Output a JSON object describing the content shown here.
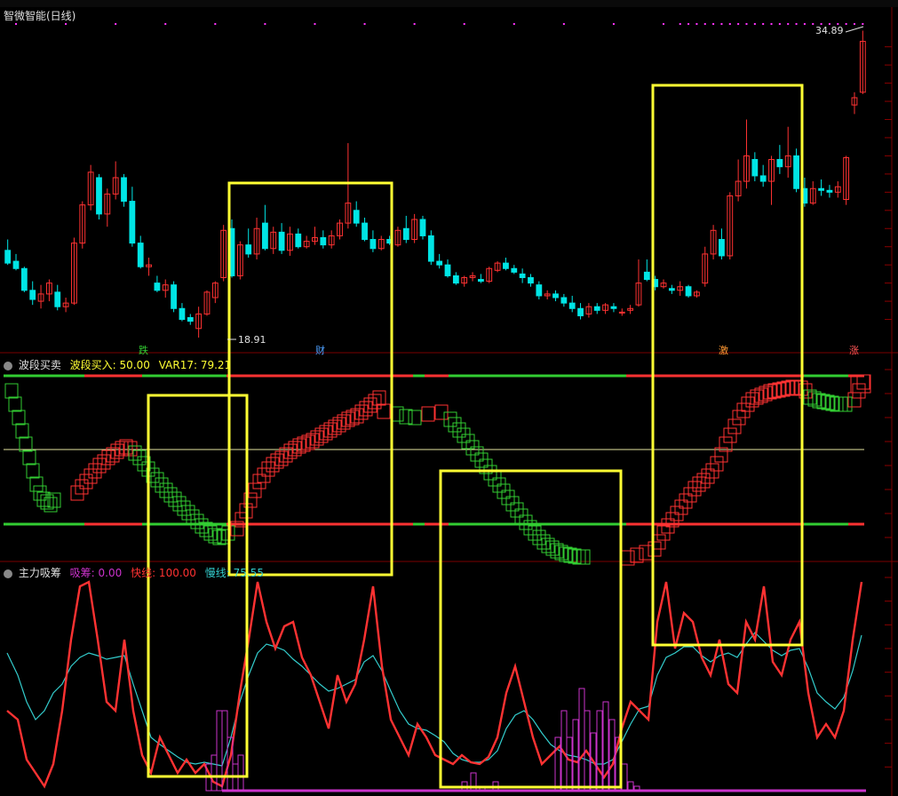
{
  "main_title": "智微智能(日线)",
  "high_label": "34.89",
  "low_label": "18.91",
  "markers": [
    "跌",
    "财",
    "激",
    "涨"
  ],
  "panel2": {
    "name": "波段买卖",
    "v1_label": "波段买入: 50.00",
    "v2_label": "VAR17: 79.21"
  },
  "panel3": {
    "name": "主力吸筹",
    "v1_label": "吸筹: 0.00",
    "v2_label": "快线: 100.00",
    "v3_label": "慢线: 75.55"
  },
  "colors": {
    "up": "#ff3232",
    "down": "#00e5e5",
    "green": "#32cd32",
    "yellow": "#ffff33",
    "magenta": "#cc33cc",
    "slow": "#33cccc",
    "grid": "#8b0000"
  },
  "chart_data": {
    "type": "candlestick",
    "candles": [
      [
        22.8,
        23.4,
        22.0,
        22.1
      ],
      [
        22.2,
        22.6,
        21.7,
        21.8
      ],
      [
        21.8,
        21.9,
        20.5,
        20.6
      ],
      [
        20.6,
        21.1,
        19.8,
        20.1
      ],
      [
        20.0,
        20.9,
        19.6,
        20.4
      ],
      [
        20.4,
        21.2,
        20.0,
        21.0
      ],
      [
        20.5,
        20.9,
        19.5,
        19.7
      ],
      [
        19.7,
        20.2,
        19.4,
        19.9
      ],
      [
        19.9,
        23.5,
        19.8,
        23.2
      ],
      [
        23.2,
        25.5,
        22.9,
        25.3
      ],
      [
        25.3,
        27.5,
        25.0,
        27.1
      ],
      [
        26.8,
        27.0,
        24.5,
        24.8
      ],
      [
        24.8,
        26.2,
        24.1,
        25.9
      ],
      [
        25.9,
        27.7,
        25.6,
        26.8
      ],
      [
        26.8,
        27.0,
        25.2,
        25.5
      ],
      [
        25.5,
        26.3,
        23.0,
        23.2
      ],
      [
        23.2,
        23.6,
        21.8,
        21.9
      ],
      [
        21.9,
        22.4,
        21.4,
        22.0
      ],
      [
        21.0,
        21.4,
        20.5,
        20.6
      ],
      [
        20.6,
        21.2,
        20.2,
        20.9
      ],
      [
        20.9,
        21.1,
        19.4,
        19.6
      ],
      [
        19.6,
        19.9,
        18.9,
        19.0
      ],
      [
        19.1,
        19.3,
        18.7,
        18.9
      ],
      [
        18.5,
        19.7,
        18.0,
        19.3
      ],
      [
        19.3,
        20.6,
        19.2,
        20.5
      ],
      [
        20.2,
        21.1,
        19.9,
        21.0
      ],
      [
        21.3,
        24.2,
        21.1,
        23.9
      ],
      [
        24.0,
        24.5,
        21.3,
        21.4
      ],
      [
        21.4,
        23.3,
        21.2,
        23.1
      ],
      [
        23.1,
        24.0,
        22.4,
        22.6
      ],
      [
        22.6,
        24.6,
        22.3,
        24.0
      ],
      [
        24.3,
        25.3,
        22.8,
        22.9
      ],
      [
        22.9,
        24.1,
        22.6,
        23.8
      ],
      [
        23.8,
        24.3,
        22.6,
        22.8
      ],
      [
        22.8,
        24.1,
        22.5,
        23.7
      ],
      [
        23.7,
        24.0,
        22.9,
        23.0
      ],
      [
        23.0,
        23.6,
        22.9,
        23.3
      ],
      [
        23.3,
        24.1,
        23.1,
        23.5
      ],
      [
        23.5,
        23.9,
        22.9,
        23.1
      ],
      [
        23.1,
        23.9,
        22.9,
        23.6
      ],
      [
        23.6,
        24.5,
        23.4,
        24.3
      ],
      [
        24.3,
        28.7,
        24.0,
        25.4
      ],
      [
        25.0,
        25.5,
        24.1,
        24.3
      ],
      [
        24.3,
        24.6,
        23.3,
        23.4
      ],
      [
        23.4,
        23.9,
        22.7,
        22.9
      ],
      [
        22.9,
        23.6,
        22.8,
        23.4
      ],
      [
        23.4,
        23.6,
        23.1,
        23.2
      ],
      [
        23.1,
        24.1,
        23.0,
        23.9
      ],
      [
        24.0,
        24.7,
        23.2,
        23.4
      ],
      [
        23.4,
        24.8,
        23.2,
        24.5
      ],
      [
        24.5,
        24.7,
        23.4,
        23.6
      ],
      [
        23.6,
        23.9,
        22.0,
        22.2
      ],
      [
        22.2,
        22.6,
        21.8,
        22.0
      ],
      [
        22.0,
        22.3,
        21.3,
        21.4
      ],
      [
        21.4,
        21.6,
        20.9,
        21.0
      ],
      [
        21.0,
        21.4,
        20.8,
        21.3
      ],
      [
        21.3,
        21.6,
        21.1,
        21.4
      ],
      [
        21.2,
        21.5,
        21.0,
        21.1
      ],
      [
        21.1,
        21.9,
        21.0,
        21.8
      ],
      [
        21.7,
        22.2,
        21.6,
        22.1
      ],
      [
        22.1,
        22.4,
        21.7,
        21.8
      ],
      [
        21.8,
        22.0,
        21.5,
        21.6
      ],
      [
        21.5,
        21.8,
        21.0,
        21.3
      ],
      [
        21.3,
        21.5,
        20.8,
        21.0
      ],
      [
        20.9,
        21.1,
        20.1,
        20.3
      ],
      [
        20.3,
        20.6,
        20.1,
        20.4
      ],
      [
        20.4,
        20.6,
        20.0,
        20.2
      ],
      [
        20.2,
        20.4,
        19.7,
        19.9
      ],
      [
        19.9,
        20.3,
        19.4,
        19.6
      ],
      [
        19.6,
        19.9,
        19.0,
        19.2
      ],
      [
        19.3,
        19.9,
        19.1,
        19.7
      ],
      [
        19.7,
        19.9,
        19.3,
        19.5
      ],
      [
        19.5,
        19.9,
        19.3,
        19.8
      ],
      [
        19.7,
        19.9,
        19.4,
        19.6
      ],
      [
        19.4,
        19.6,
        19.2,
        19.4
      ],
      [
        19.5,
        19.8,
        19.3,
        19.6
      ],
      [
        19.8,
        22.3,
        19.7,
        21.0
      ],
      [
        21.6,
        22.3,
        21.1,
        21.2
      ],
      [
        21.2,
        21.4,
        20.6,
        20.8
      ],
      [
        20.8,
        21.2,
        20.7,
        21.0
      ],
      [
        20.7,
        20.9,
        20.4,
        20.6
      ],
      [
        20.6,
        21.1,
        20.3,
        20.8
      ],
      [
        20.8,
        20.9,
        20.2,
        20.3
      ],
      [
        20.3,
        20.6,
        20.2,
        20.5
      ],
      [
        21.0,
        23.0,
        20.8,
        22.6
      ],
      [
        22.6,
        24.2,
        22.3,
        23.9
      ],
      [
        23.4,
        24.0,
        22.3,
        22.5
      ],
      [
        22.5,
        26.0,
        22.3,
        25.8
      ],
      [
        25.8,
        27.8,
        25.5,
        26.6
      ],
      [
        26.6,
        30.0,
        26.2,
        28.0
      ],
      [
        27.8,
        28.2,
        26.6,
        26.9
      ],
      [
        26.9,
        27.5,
        26.3,
        26.6
      ],
      [
        26.6,
        28.0,
        25.3,
        27.8
      ],
      [
        27.8,
        28.6,
        27.0,
        27.4
      ],
      [
        27.4,
        29.6,
        26.8,
        28.0
      ],
      [
        28.0,
        28.4,
        26.0,
        26.2
      ],
      [
        26.2,
        26.8,
        25.2,
        25.4
      ],
      [
        25.4,
        26.6,
        25.3,
        26.2
      ],
      [
        26.2,
        26.7,
        25.8,
        26.1
      ],
      [
        26.1,
        26.4,
        25.7,
        26.0
      ],
      [
        26.0,
        26.6,
        25.7,
        26.3
      ],
      [
        25.6,
        28.0,
        25.3,
        27.9
      ],
      [
        30.8,
        31.5,
        30.3,
        31.2
      ],
      [
        31.5,
        34.89,
        31.4,
        34.3
      ]
    ],
    "yticks_price": [
      19,
      20,
      21,
      22,
      23,
      24,
      25,
      26,
      27,
      28,
      29,
      30,
      31,
      32,
      33,
      34
    ]
  }
}
